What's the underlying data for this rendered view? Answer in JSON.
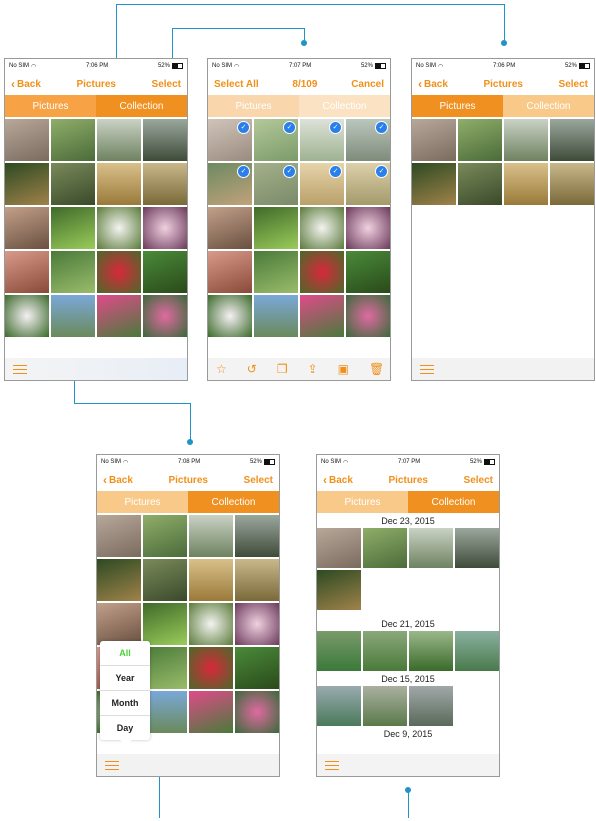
{
  "colors": {
    "accent": "#f0901a",
    "segment_on": "#f7a245",
    "connector": "#1e94c8",
    "check": "#2a7fe8"
  },
  "status_bar": {
    "carrier": "No SIM",
    "battery": "52%",
    "times": [
      "7:06 PM",
      "7:07 PM",
      "7:06 PM",
      "7:08 PM",
      "7:07 PM"
    ]
  },
  "screens": {
    "s1": {
      "back": "Back",
      "title": "Pictures",
      "select": "Select",
      "tab_pictures": "Pictures",
      "tab_collection": "Collection"
    },
    "s2": {
      "select_all": "Select All",
      "title": "8/109",
      "cancel": "Cancel",
      "tab_pictures": "Pictures",
      "tab_collection": "Collection"
    },
    "s3": {
      "back": "Back",
      "title": "Pictures",
      "select": "Select",
      "tab_pictures": "Pictures",
      "tab_collection": "Collection"
    },
    "s4": {
      "back": "Back",
      "title": "Pictures",
      "select": "Select",
      "tab_pictures": "Pictures",
      "tab_collection": "Collection",
      "menu": {
        "all": "All",
        "year": "Year",
        "month": "Month",
        "day": "Day"
      }
    },
    "s5": {
      "back": "Back",
      "title": "Pictures",
      "select": "Select",
      "tab_pictures": "Pictures",
      "tab_collection": "Collection",
      "dates": [
        "Dec 23, 2015",
        "Dec 21, 2015",
        "Dec 15, 2015",
        "Dec 9, 2015"
      ]
    }
  },
  "icons": {
    "back": "chevron-left-icon",
    "list": "list-icon",
    "check": "checkmark-icon",
    "star": "star-icon",
    "rotate": "rotate-icon",
    "copy": "copy-icon",
    "share": "share-icon",
    "move": "move-icon",
    "trash": "trash-icon"
  }
}
